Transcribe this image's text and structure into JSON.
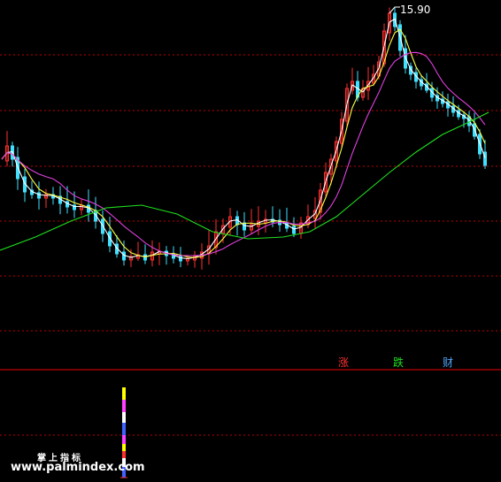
{
  "chart": {
    "peak_label": "15.90",
    "colors": {
      "background": "#000000",
      "grid": "#c00000",
      "panel_divider": "#c00000",
      "candle_up": "#ff3030",
      "candle_down": "#40e0ff",
      "ma_white": "#ffffff",
      "ma_yellow": "#ffff40",
      "ma_magenta": "#e040e0",
      "ma_green": "#20e020"
    }
  },
  "legend": {
    "rise": {
      "label": "涨",
      "color": "#ff3030"
    },
    "fall": {
      "label": "跌",
      "color": "#20e020"
    },
    "wealth": {
      "label": "财",
      "color": "#4fa8ff"
    }
  },
  "watermark": {
    "title": "掌上指标",
    "url": "www.palmindex.com"
  }
}
